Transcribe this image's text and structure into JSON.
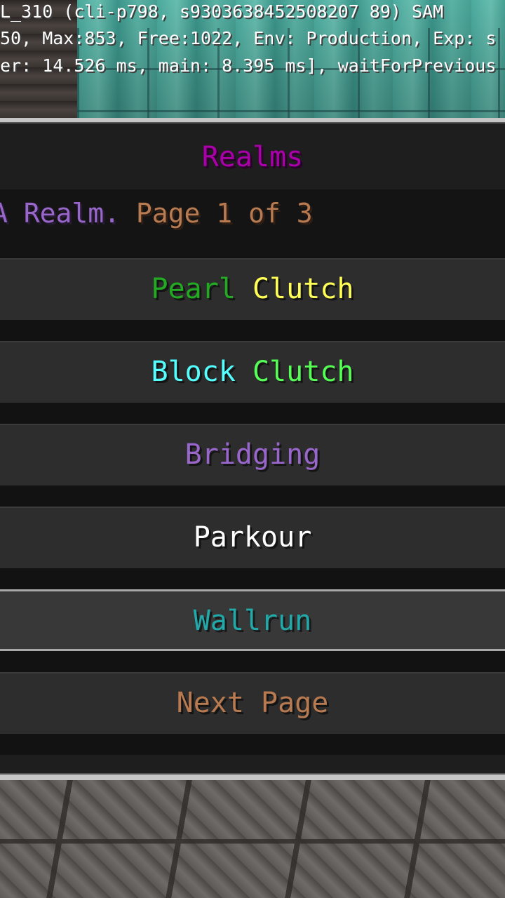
{
  "debug": {
    "line1": "L_310 (cli-p798, s9303638452508207 89) SAM",
    "line2": "50, Max:853, Free:1022, Env: Production, Exp: s",
    "line3": "er: 14.526 ms, main: 8.395 ms], waitForPrevious"
  },
  "menu": {
    "title": "Realms",
    "subtitle_realm": "A Realm.",
    "subtitle_page": "Page 1 of 3",
    "colors": {
      "title": "#aa00aa",
      "realm_text": "#9966cc",
      "page_text": "#b87a50"
    },
    "buttons": [
      {
        "parts": [
          {
            "text": "Pearl",
            "color": "#22aa22"
          },
          {
            "text": "Clutch",
            "color": "#ffff55"
          }
        ]
      },
      {
        "parts": [
          {
            "text": "Block",
            "color": "#55ffff"
          },
          {
            "text": "Clutch",
            "color": "#55ff55"
          }
        ]
      },
      {
        "parts": [
          {
            "text": "Bridging",
            "color": "#9966cc"
          }
        ]
      },
      {
        "parts": [
          {
            "text": "Parkour",
            "color": "#ffffff"
          }
        ]
      },
      {
        "parts": [
          {
            "text": "Wallrun",
            "color": "#22aaaa"
          }
        ],
        "selected": true
      },
      {
        "parts": [
          {
            "text": "Next Page",
            "color": "#b87a50"
          }
        ]
      }
    ]
  }
}
